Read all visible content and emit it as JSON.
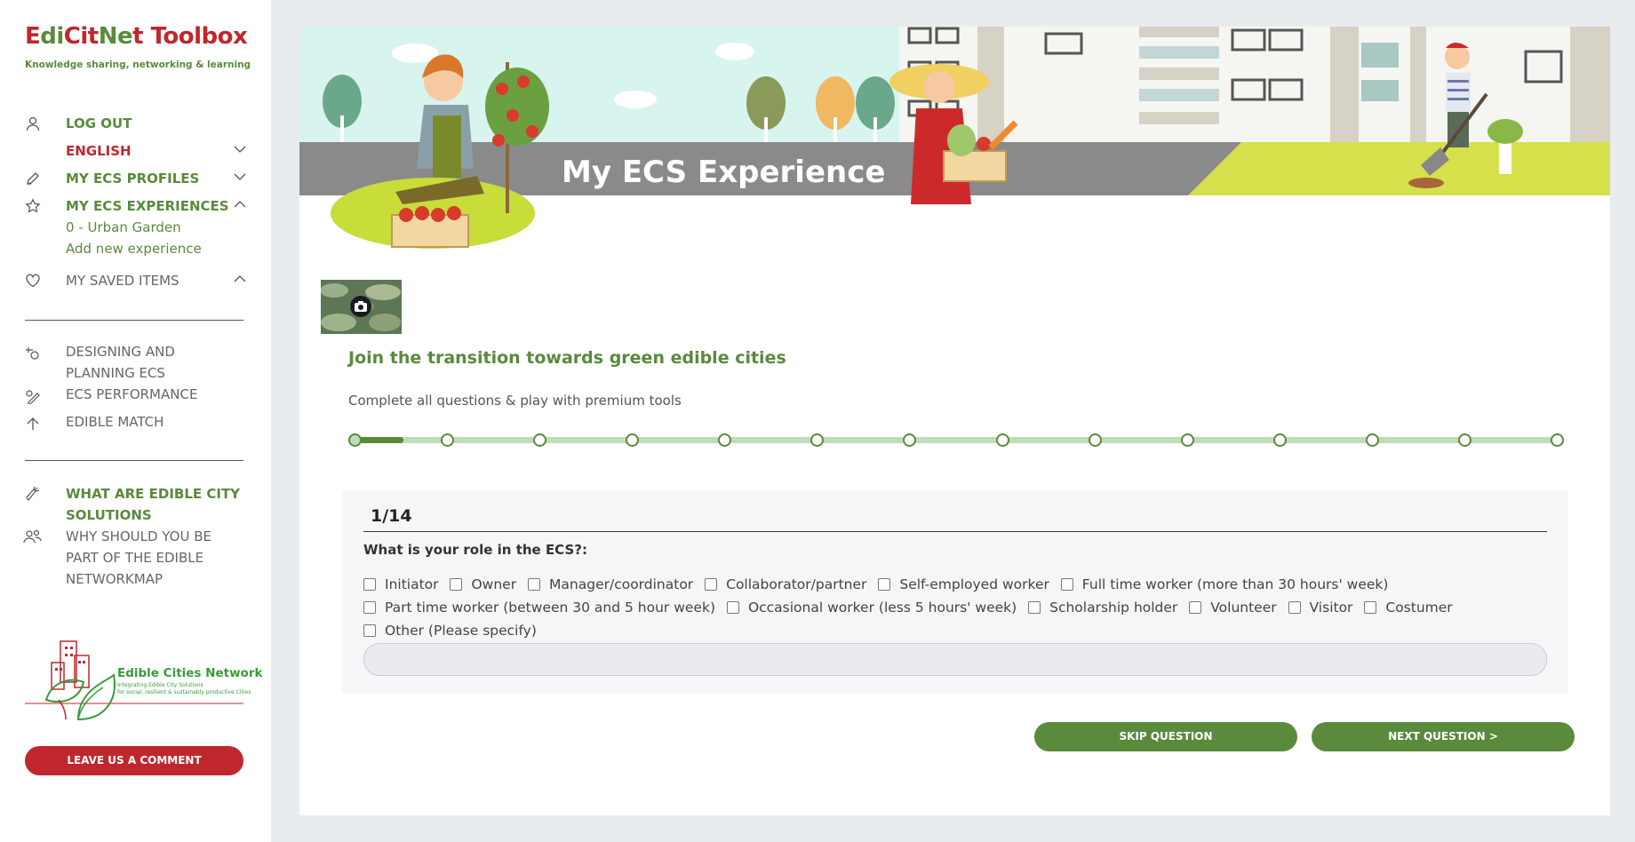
{
  "brand": {
    "title_e": "E",
    "title_di": "di",
    "title_cit": "Cit",
    "title_net": "Ne",
    "title_t": "t",
    "title_toolbox": "Toolbox",
    "tagline": "Knowledge sharing, networking & learning"
  },
  "sidebar": {
    "logout": "LOG OUT",
    "language": "ENGLISH",
    "profiles": "MY ECS PROFILES",
    "experiences": "MY ECS EXPERIENCES",
    "experience_items": [
      "0 - Urban Garden",
      "Add new experience"
    ],
    "saved": "MY SAVED ITEMS",
    "tools": [
      {
        "label": "DESIGNING AND PLANNING ECS"
      },
      {
        "label": "ECS PERFORMANCE"
      },
      {
        "label": "EDIBLE MATCH"
      }
    ],
    "info": [
      {
        "label": "WHAT ARE EDIBLE CITY SOLUTIONS"
      },
      {
        "label": "WHY SHOULD YOU BE PART OF THE EDIBLE NETWORKMAP"
      }
    ],
    "logo_title": "Edible Cities Network",
    "logo_sub1": "Integrating Edible City Solutions",
    "logo_sub2": "for social, resilient & sustainably productive Cities",
    "comment_button": "LEAVE US A COMMENT"
  },
  "main": {
    "banner_title": "My ECS Experience",
    "heading": "Join the transition towards green edible cities",
    "subheading": "Complete all questions & play with premium tools",
    "progress": {
      "total_steps": 14,
      "current_step": 1,
      "fill_fraction": 0.045
    },
    "question": {
      "number": "1/14",
      "text": "What is your role in the ECS?:",
      "options": [
        "Initiator",
        "Owner",
        "Manager/coordinator",
        "Collaborator/partner",
        "Self-employed worker",
        "Full time worker (more than 30 hours' week)",
        "Part time worker (between 30 and 5 hour week)",
        "Occasional worker (less 5 hours' week)",
        "Scholarship holder",
        "Volunteer",
        "Visitor",
        "Costumer",
        "Other (Please specify)"
      ],
      "other_value": ""
    },
    "skip_button": "SKIP QUESTION",
    "next_button": "NEXT QUESTION >"
  },
  "colors": {
    "brand_green": "#5a8a3c",
    "brand_red": "#c0272d",
    "progress_track": "#bfdcb8",
    "page_bg": "#e8ecef"
  }
}
